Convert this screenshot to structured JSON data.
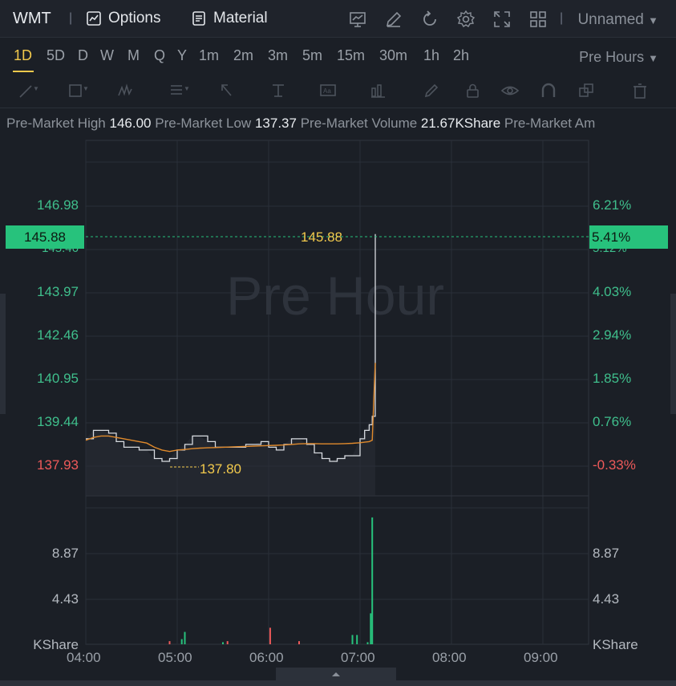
{
  "header": {
    "ticker": "WMT",
    "options_label": "Options",
    "material_label": "Material",
    "layout_label": "Unnamed",
    "icons": [
      "chart-indicator-icon",
      "draw-edit-icon",
      "refresh-icon",
      "settings-icon",
      "fullscreen-icon",
      "grid-layout-icon"
    ]
  },
  "periods": [
    "1D",
    "5D",
    "D",
    "W",
    "M",
    "Q",
    "Y",
    "1m",
    "2m",
    "3m",
    "5m",
    "15m",
    "30m",
    "1h",
    "2h"
  ],
  "active_period": "1D",
  "session_label": "Pre Hours",
  "stats": [
    {
      "label": "Pre-Market High",
      "value": "146.00"
    },
    {
      "label": "Pre-Market Low",
      "value": "137.37"
    },
    {
      "label": "Pre-Market Volume",
      "value": "21.67KShare"
    },
    {
      "label": "Pre-Market Am",
      "value": ""
    }
  ],
  "watermark": "Pre Hour",
  "price_axis_left": [
    "146.98",
    "143.97",
    "142.46",
    "140.95",
    "139.44",
    "137.93"
  ],
  "price_axis_right": [
    "6.21%",
    "4.03%",
    "2.94%",
    "1.85%",
    "0.76%",
    "-0.33%"
  ],
  "current_price": {
    "price": "145.88",
    "percent": "5.41%",
    "line_label": "145.88"
  },
  "hidden_tick": {
    "left": "145.46",
    "right": "5.12%"
  },
  "low_label": "137.80",
  "volume_axis": [
    "8.87",
    "4.43",
    "KShare"
  ],
  "time_axis": [
    "04:00",
    "05:00",
    "06:00",
    "07:00",
    "08:00",
    "09:00"
  ],
  "colors": {
    "up": "#27c27c",
    "down": "#ef5a5a",
    "accent": "#f2c94c",
    "avg_line": "#e08a2c",
    "price_line": "#d8dbe0"
  },
  "chart_data": {
    "type": "line",
    "title": "",
    "x": [
      "04:00",
      "04:05",
      "04:10",
      "04:15",
      "04:20",
      "04:25",
      "04:30",
      "04:35",
      "04:40",
      "04:45",
      "04:50",
      "04:55",
      "05:00",
      "05:05",
      "05:10",
      "05:15",
      "05:20",
      "05:25",
      "05:30",
      "05:35",
      "05:40",
      "05:45",
      "05:50",
      "05:55",
      "06:00",
      "06:05",
      "06:10",
      "06:15",
      "06:20",
      "06:25",
      "06:30",
      "06:35",
      "06:40",
      "06:45",
      "06:50",
      "06:55",
      "07:00",
      "07:03",
      "07:06",
      "07:08",
      "07:10"
    ],
    "series": [
      {
        "name": "",
        "values": [
          138.6,
          138.9,
          138.9,
          138.8,
          138.5,
          138.3,
          138.3,
          138.2,
          138.2,
          137.9,
          137.8,
          137.9,
          138.2,
          138.4,
          138.7,
          138.7,
          138.5,
          138.3,
          138.3,
          138.3,
          138.3,
          138.4,
          138.4,
          138.5,
          138.3,
          138.2,
          138.4,
          138.6,
          138.6,
          138.4,
          138.1,
          137.9,
          137.8,
          137.9,
          138.0,
          138.0,
          138.6,
          138.9,
          139.1,
          139.4,
          145.88
        ]
      },
      {
        "name": "",
        "values": [
          138.55,
          138.65,
          138.7,
          138.7,
          138.65,
          138.6,
          138.55,
          138.5,
          138.45,
          138.3,
          138.2,
          138.15,
          138.2,
          138.22,
          138.25,
          138.27,
          138.28,
          138.29,
          138.3,
          138.31,
          138.32,
          138.33,
          138.34,
          138.35,
          138.36,
          138.37,
          138.38,
          138.4,
          138.42,
          138.43,
          138.43,
          138.42,
          138.42,
          138.42,
          138.43,
          138.44,
          138.46,
          138.48,
          138.5,
          138.55,
          141.3
        ]
      }
    ],
    "volume": [
      {
        "x": "04:55",
        "v": 0.3,
        "dir": "down"
      },
      {
        "x": "05:03",
        "v": 0.5,
        "dir": "up"
      },
      {
        "x": "05:05",
        "v": 1.2,
        "dir": "up"
      },
      {
        "x": "05:30",
        "v": 0.2,
        "dir": "up"
      },
      {
        "x": "05:33",
        "v": 0.3,
        "dir": "down"
      },
      {
        "x": "06:01",
        "v": 1.6,
        "dir": "down"
      },
      {
        "x": "06:20",
        "v": 0.3,
        "dir": "down"
      },
      {
        "x": "06:55",
        "v": 0.9,
        "dir": "up"
      },
      {
        "x": "06:58",
        "v": 0.9,
        "dir": "up"
      },
      {
        "x": "07:05",
        "v": 0.2,
        "dir": "up"
      },
      {
        "x": "07:07",
        "v": 3.0,
        "dir": "up"
      },
      {
        "x": "07:08",
        "v": 12.3,
        "dir": "up"
      }
    ],
    "ylim": [
      137.0,
      148.5
    ],
    "volume_ylim": [
      0,
      13.3
    ],
    "grid": true
  }
}
